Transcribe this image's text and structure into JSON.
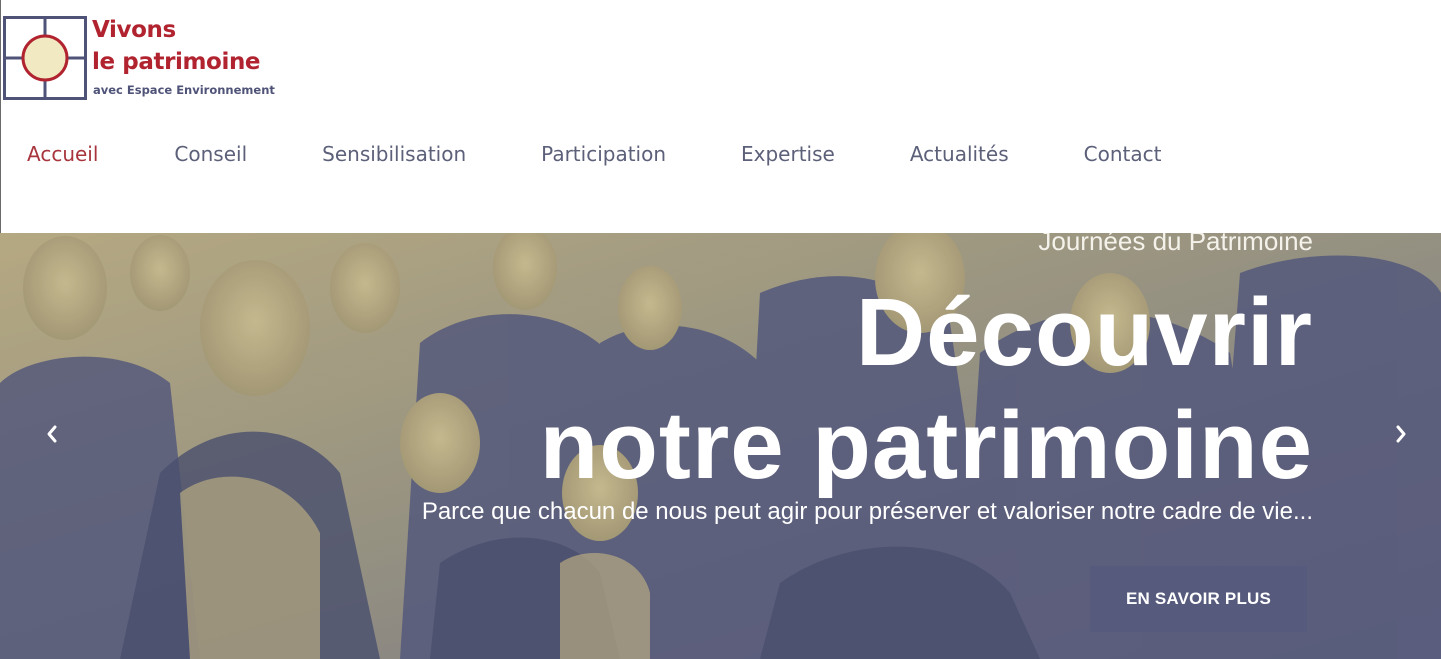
{
  "brand": {
    "name_line1": "Vivons",
    "name_line2": "le patrimoine",
    "subtitle": "avec Espace Environnement",
    "color_primary": "#b0232f",
    "color_secondary": "#4f5378",
    "logo_fill": "#f1e9c2"
  },
  "nav": {
    "items": [
      {
        "label": "Accueil",
        "active": true
      },
      {
        "label": "Conseil",
        "active": false
      },
      {
        "label": "Sensibilisation",
        "active": false
      },
      {
        "label": "Participation",
        "active": false
      },
      {
        "label": "Expertise",
        "active": false
      },
      {
        "label": "Actualités",
        "active": false
      },
      {
        "label": "Contact",
        "active": false
      }
    ],
    "active_color": "#a8353d",
    "color": "#5c6079"
  },
  "hero": {
    "eyebrow": "Journées du Patrimoine",
    "headline_line1": "Découvrir",
    "headline_line2": "notre patrimoine",
    "tagline": "Parce que chacun de nous peut agir pour préserver et valoriser notre cadre de vie...",
    "cta_label": "EN SAVOIR PLUS",
    "cta_color": "#565a7c",
    "prev_icon": "chevron-left-icon",
    "next_icon": "chevron-right-icon",
    "tint_light": "#c8b98a",
    "tint_dark": "#5a5e80"
  }
}
